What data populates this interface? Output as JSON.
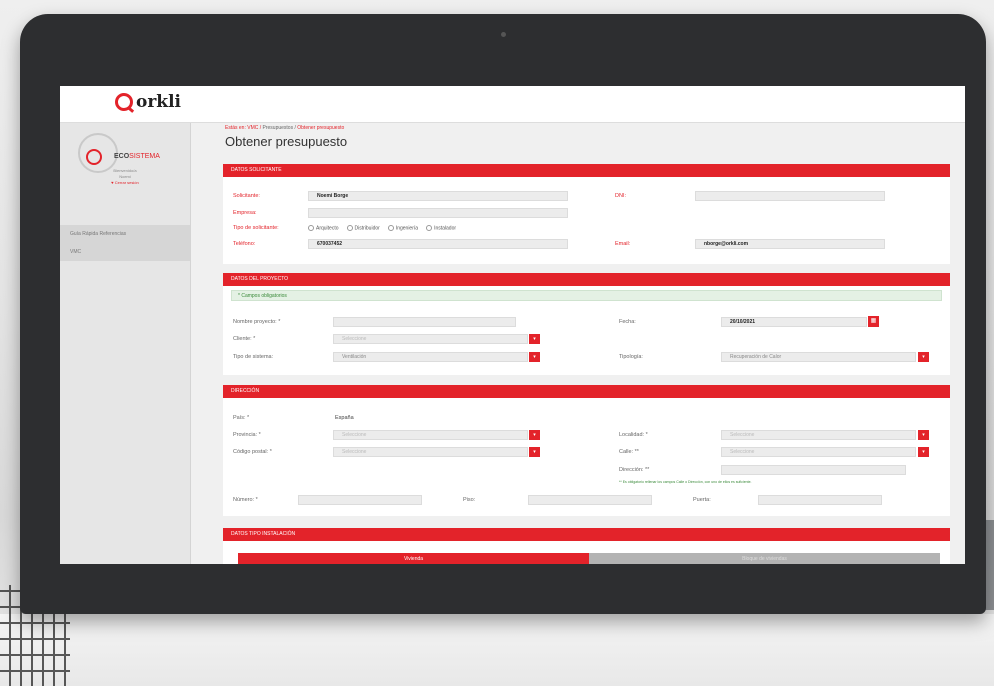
{
  "brand": {
    "logo_text": "orkli",
    "accent": "#e3232a"
  },
  "sidebar": {
    "eco_title": "ECO",
    "eco_subtitle": "SISTEMA",
    "welcome_line1": "Bienvenido/a",
    "welcome_line2": "Noemi",
    "close_session": "♥ Cerrar sesión",
    "items": [
      {
        "label": "Guía Rápida Referencias"
      },
      {
        "label": "VMC"
      }
    ]
  },
  "breadcrumb": {
    "prefix": "Estás en: VMC /",
    "middle": "Presupuestos /",
    "current": "Obtener presupuesto"
  },
  "page_title": "Obtener presupuesto",
  "solicitante": {
    "header": "DATOS SOLICITANTE",
    "solicitante_label": "Solicitante:",
    "solicitante_value": "Noemi Borge",
    "empresa_label": "Empresa:",
    "tipo_label": "Tipo de solicitante:",
    "tipo_options": [
      "Arquitecto",
      "Distribuidor",
      "Ingeniería",
      "Instalador"
    ],
    "telefono_label": "Teléfono:",
    "telefono_value": "670037452",
    "dni_label": "DNI:",
    "email_label": "Email:",
    "email_value": "nborge@orkli.com"
  },
  "proyecto": {
    "header": "DATOS DEL PROYECTO",
    "required_note": "* Campos obligatorios",
    "nombre_label": "Nombre proyecto: *",
    "cliente_label": "Cliente: *",
    "cliente_value": "Seleccione",
    "tipo_sistema_label": "Tipo de sistema:",
    "tipo_sistema_value": "Ventilación",
    "fecha_label": "Fecha:",
    "fecha_value": "20/10/2021",
    "tipologia_label": "Tipología:",
    "tipologia_value": "Recuperación de Calor"
  },
  "direccion": {
    "header": "DIRECCIÓN",
    "pais_label": "País: *",
    "pais_value": "España",
    "provincia_label": "Provincia: *",
    "provincia_value": "Seleccione",
    "cp_label": "Código postal: *",
    "cp_value": "Seleccione",
    "localidad_label": "Localidad: *",
    "localidad_value": "Seleccione",
    "calle_label": "Calle: **",
    "calle_value": "Seleccione",
    "direccion_label": "Dirección: **",
    "note": "** Es obligatorio rellenar los campos Calle o Dirección, con uno de ellos es suficiente.",
    "numero_label": "Número: *",
    "piso_label": "Piso:",
    "puerta_label": "Puerta:"
  },
  "instalacion": {
    "header": "DATOS TIPO INSTALACIÓN",
    "tab_active": "Vivienda",
    "tab_inactive": "Bloque de viviendas"
  }
}
